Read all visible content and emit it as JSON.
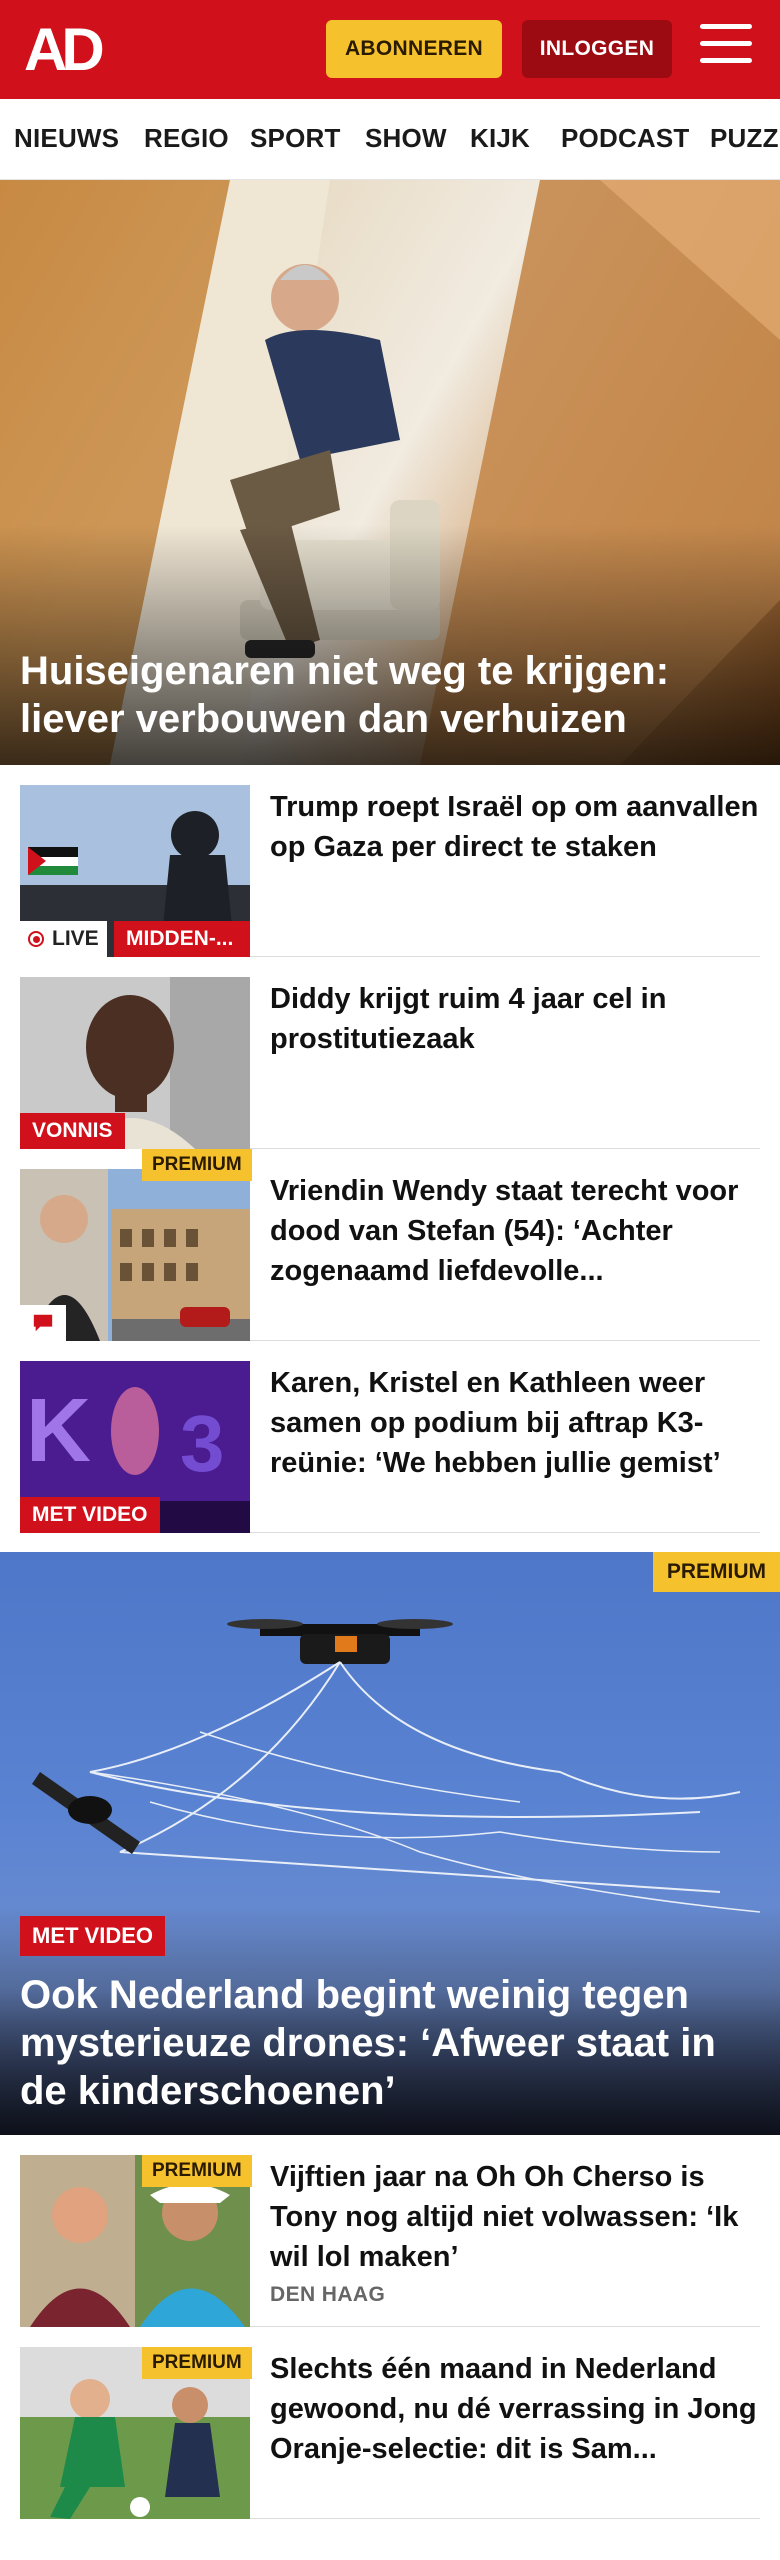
{
  "header": {
    "logo_text": "AD",
    "subscribe_label": "ABONNEREN",
    "login_label": "INLOGGEN",
    "brand_color": "#d0101a",
    "menu_icon": "hamburger-menu-icon"
  },
  "nav": {
    "items": [
      "NIEUWS",
      "REGIO",
      "SPORT",
      "SHOW",
      "KIJK",
      "PODCAST",
      "PUZZ"
    ]
  },
  "hero": {
    "title": "Huiseigenaren niet weg te krijgen: liever verbouwen dan verhuizen"
  },
  "articles": [
    {
      "title": "Trump roept Israël op om aanvallen op Gaza per direct te staken",
      "live_label": "LIVE",
      "tag": "MIDDEN-..."
    },
    {
      "title": "Diddy krijgt ruim 4 jaar cel in prostitutiezaak",
      "tag": "VONNIS"
    },
    {
      "title": "Vriendin Wendy staat terecht voor dood van Stefan (54): ‘Achter zogenaamd liefdevolle...",
      "premium": "PREMIUM",
      "icon": "comment-icon"
    },
    {
      "title": "Karen, Kristel en Kathleen weer samen op podium bij aftrap K3-reünie: ‘We hebben jullie gemist’",
      "tag": "MET VIDEO"
    }
  ],
  "feature": {
    "premium": "PREMIUM",
    "tag": "MET VIDEO",
    "title": "Ook Nederland begint weinig tegen mysterieuze drones: ‘Afweer staat in de kinderschoenen’"
  },
  "articles2": [
    {
      "title": "Vijftien jaar na Oh Oh Cherso is Tony nog altijd niet volwassen: ‘Ik wil lol maken’",
      "premium": "PREMIUM",
      "location": "DEN HAAG"
    },
    {
      "title": "Slechts één maand in Nederland gewoond, nu dé verrassing in Jong Oranje-selectie: dit is Sam...",
      "premium": "PREMIUM"
    }
  ]
}
